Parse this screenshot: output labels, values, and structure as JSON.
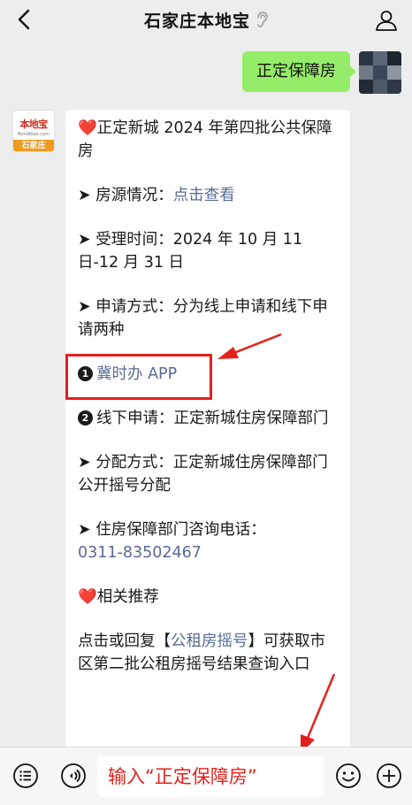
{
  "header": {
    "title": "石家庄本地宝",
    "back_icon": "chevron-left-icon",
    "title_icon": "ear-icon",
    "profile_icon": "user-icon"
  },
  "outgoing": {
    "text": "正定保障房"
  },
  "incoming": {
    "avatar": {
      "logo_text": "本地宝",
      "logo_url": "Bendibao.com",
      "city_label": "石家庄"
    },
    "heart": "❤️",
    "title": "正定新城 2024 年第四批公共保障房",
    "arrow": "➤",
    "source_label": "房源情况：",
    "source_link": "点击查看",
    "time_label": "受理时间：",
    "time_value": "2024 年 10 月 11 日-12 月 31 日",
    "method_label": "申请方式：",
    "method_value": "分为线上申请和线下申请两种",
    "item1_num": "1",
    "item1_link": "冀时办 APP",
    "item2_num": "2",
    "item2_label": "线下申请：",
    "item2_value": "正定新城住房保障部门",
    "alloc_label": "分配方式：",
    "alloc_value": "正定新城住房保障部门公开摇号分配",
    "phone_label": "住房保障部门咨询电话：",
    "phone_value": "0311-83502467",
    "related": "相关推荐",
    "recommend_pre": "点击或回复【",
    "recommend_link": "公租房摇号",
    "recommend_post": "】可获取市区第二批公租房摇号结果查询入口"
  },
  "annotation": {
    "input_hint": "输入“正定保障房”",
    "color": "#e3211c"
  },
  "bottombar": {
    "menu_icon": "menu-list-icon",
    "voice_icon": "voice-icon",
    "emoji_icon": "emoji-icon",
    "add_icon": "plus-icon"
  },
  "colors": {
    "bubble_out": "#95ec69",
    "link": "#576b95",
    "background": "#ededed"
  }
}
